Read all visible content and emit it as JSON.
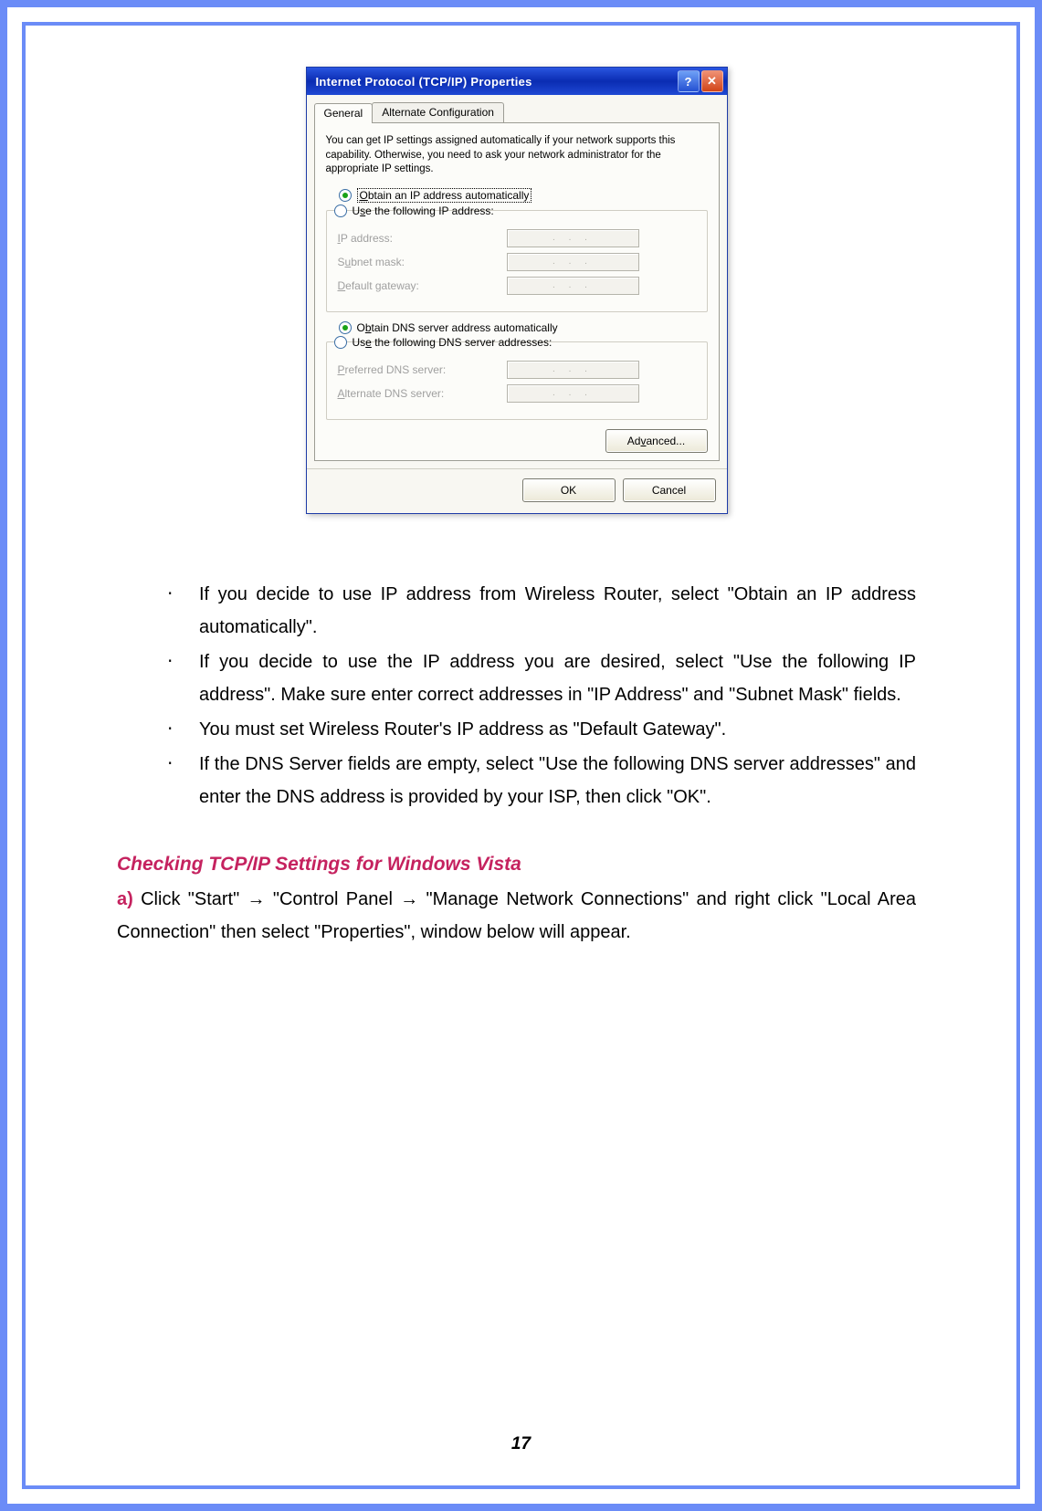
{
  "dialog": {
    "title": "Internet Protocol (TCP/IP) Properties",
    "titlebar": {
      "help_glyph": "?",
      "close_glyph": "✕"
    },
    "tabs": {
      "general": "General",
      "alt": "Alternate Configuration"
    },
    "intro": "You can get IP settings assigned automatically if your network supports this capability. Otherwise, you need to ask your network administrator for the appropriate IP settings.",
    "ip": {
      "auto": "Obtain an IP address automatically",
      "manual": "Use the following IP address:",
      "ip_label": "IP address:",
      "mask_label": "Subnet mask:",
      "gw_label": "Default gateway:"
    },
    "dns": {
      "auto": "Obtain DNS server address automatically",
      "manual": "Use the following DNS server addresses:",
      "pref_label": "Preferred DNS server:",
      "alt_label": "Alternate DNS server:"
    },
    "buttons": {
      "advanced": "Advanced...",
      "ok": "OK",
      "cancel": "Cancel"
    },
    "dots": ".  .  ."
  },
  "bullets": {
    "b1": "If you decide to use IP address from Wireless Router, select \"Obtain an IP address automatically\".",
    "b2": "If you decide to use the IP address you are desired, select \"Use the following IP address\". Make sure enter correct addresses in \"IP Address\" and \"Subnet Mask\" fields.",
    "b3": "You must set Wireless Router's IP address as \"Default Gateway\".",
    "b4": "If the DNS Server fields are empty, select \"Use the following DNS server addresses\" and enter the DNS address is provided by your ISP, then click \"OK\"."
  },
  "section_title": "Checking TCP/IP Settings for Windows Vista",
  "step_a": {
    "label": "a)",
    "pre": " Click \"Start\" ",
    "arrow": "→",
    "mid1": " \"Control Panel ",
    "mid2": "  \"Manage Network Connections\" and right click \"Local Area Connection\" then select \"Properties\", window below will appear."
  },
  "page_number": "17"
}
